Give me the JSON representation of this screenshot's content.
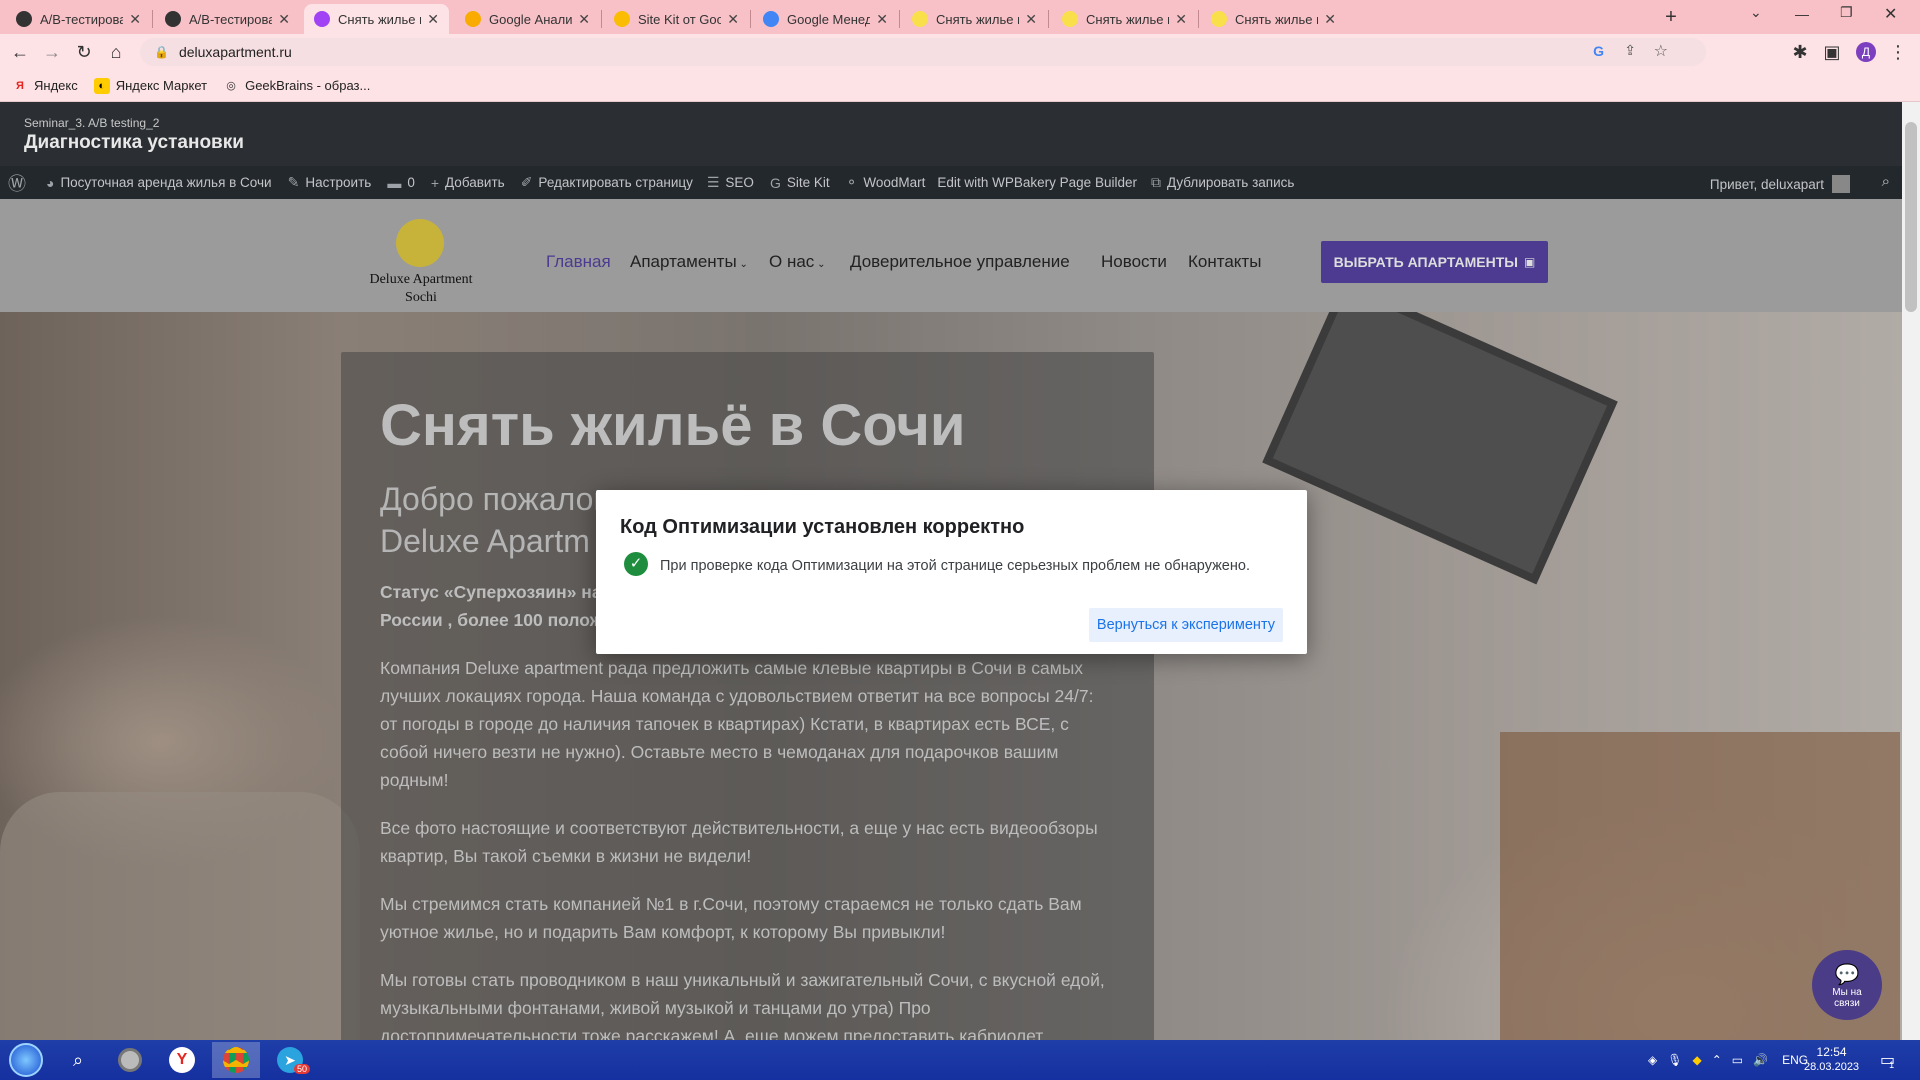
{
  "browser": {
    "tabs": [
      {
        "title": "A/B-тестирование ве",
        "favicon_color": "#333333",
        "active": false
      },
      {
        "title": "A/B-тестирование ве",
        "favicon_color": "#333333",
        "active": false
      },
      {
        "title": "Снять жилье в Сочи п",
        "favicon_color": "#a142f4",
        "active": true
      },
      {
        "title": "Google Аналитика",
        "favicon_color": "#f9ab00",
        "active": false
      },
      {
        "title": "Site Kit от Google Па",
        "favicon_color": "#fbbc04",
        "active": false
      },
      {
        "title": "Google Менеджер те",
        "favicon_color": "#4285f4",
        "active": false
      },
      {
        "title": "Снять жилье в Сочи",
        "favicon_color": "#f9e04b",
        "active": false
      },
      {
        "title": "Снять жилье в Сочи",
        "favicon_color": "#f9e04b",
        "active": false
      },
      {
        "title": "Снять жилье в Сочи",
        "favicon_color": "#f9e04b",
        "active": false
      }
    ],
    "new_tab_label": "+",
    "url": "deluxapartment.ru",
    "profile_initial": "Д",
    "bookmarks": [
      {
        "label": "Яндекс",
        "icon": "yandex-icon"
      },
      {
        "label": "Яндекс Маркет",
        "icon": "yandex-market-icon"
      },
      {
        "label": "GeekBrains - образ...",
        "icon": "geekbrains-icon"
      }
    ]
  },
  "optimize_header": {
    "subtitle": "Seminar_3. A/B testing_2",
    "title": "Диагностика установки"
  },
  "wp_admin": {
    "items": [
      {
        "label": "Посуточная аренда жилья в Сочи",
        "icon": "dashboard-icon"
      },
      {
        "label": "Настроить",
        "icon": "brush-icon"
      },
      {
        "label": "0",
        "icon": "comment-icon"
      },
      {
        "label": "Добавить",
        "icon": "plus-icon"
      },
      {
        "label": "Редактировать страницу",
        "icon": "pencil-icon"
      },
      {
        "label": "SEO",
        "icon": "seo-icon"
      },
      {
        "label": "Site Kit",
        "icon": "google-g-icon"
      },
      {
        "label": "WoodMart",
        "icon": "woodmart-icon"
      },
      {
        "label": "Edit with WPBakery Page Builder",
        "icon": ""
      },
      {
        "label": "Дублировать запись",
        "icon": "copy-icon"
      }
    ],
    "greeting": "Привет, deluxapart"
  },
  "site": {
    "logo_line1": "Deluxe Apartment",
    "logo_line2": "Sochi",
    "nav": [
      "Главная",
      "Апартаменты",
      "О нас",
      "Доверительное управление",
      "Новости",
      "Контакты"
    ],
    "cta": "ВЫБРАТЬ АПАРТАМЕНТЫ",
    "hero_title": "Снять жильё в Сочи",
    "hero_sub1": "Добро пожалов",
    "hero_sub2": "Deluxe Apartm",
    "status1": "Статус «Суперхозяин» на",
    "status2": "России , более 100 полож",
    "para1": "Компания Deluxe apartment рада предложить самые клевые квартиры в Сочи в самых лучших локациях города. Наша команда с удовольствием ответит на все вопросы 24/7: от погоды в городе до наличия тапочек в квартирах) Кстати, в квартирах есть ВСЕ, с собой ничего везти не нужно). Оставьте место в чемоданах для подарочков вашим родным!",
    "para2": "Все фото настоящие и соответствуют действительности, а еще у нас есть видеообзоры квартир, Вы такой съемки в жизни не видели!",
    "para3": "Мы стремимся стать компанией №1 в г.Сочи, поэтому стараемся не только сдать Вам уютное жилье, но и подарить Вам комфорт, к которому Вы привыкли!",
    "para4": "Мы готовы стать проводником в наш уникальный и зажигательный Сочи, с вкусной едой, музыкальными фонтанами, живой музыкой и танцами до утра) Про достопримечательности тоже расскажем! А, еще можем предоставить кабриолет",
    "chat_label": "Мы на связи"
  },
  "modal": {
    "title": "Код Оптимизации установлен корректно",
    "message": "При проверке кода Оптимизации на этой странице серьезных проблем не обнаружено.",
    "button": "Вернуться к эксперименту"
  },
  "taskbar": {
    "lang": "ENG",
    "time": "12:54",
    "date": "28.03.2023",
    "telegram_badge": "50",
    "notif_count": "1"
  },
  "colors": {
    "tab_bar": "#f7c1c7",
    "accent_purple": "#5b3fa6",
    "modal_button_text": "#1a73e8",
    "check_green": "#1e8e3e"
  }
}
